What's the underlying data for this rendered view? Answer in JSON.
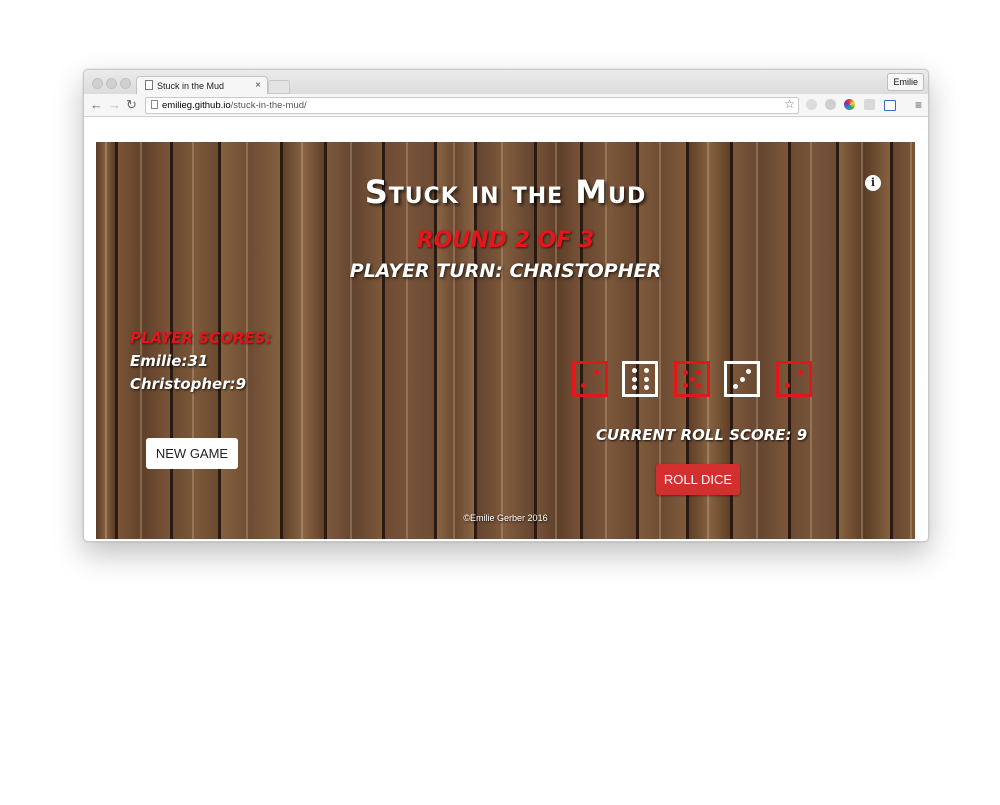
{
  "browser": {
    "tab_title": "Stuck in the Mud",
    "tab_close": "×",
    "profile_name": "Emilie",
    "url_domain": "emilieg.github.io",
    "url_path": "/stuck-in-the-mud/",
    "back": "←",
    "forward": "→",
    "reload": "↻",
    "bookmark": "☆",
    "menu": "≡"
  },
  "game": {
    "title": "Stuck in the Mud",
    "round": "ROUND 2 OF 3",
    "player_turn": "PLAYER TURN: CHRISTOPHER",
    "info": "i",
    "scores_heading": "PLAYER SCORES:",
    "scores": [
      "Emilie:31",
      "Christopher:9"
    ],
    "new_game_label": "NEW GAME",
    "current_roll_score": "CURRENT ROLL SCORE: 9",
    "roll_dice_label": "ROLL DICE",
    "footer": "©Emilie Gerber 2016",
    "dice": [
      {
        "value": 2,
        "color": "red"
      },
      {
        "value": 6,
        "color": "white"
      },
      {
        "value": 5,
        "color": "red"
      },
      {
        "value": 3,
        "color": "white"
      },
      {
        "value": 2,
        "color": "red"
      }
    ],
    "colors": {
      "red": "#e4161b",
      "white": "#ffffff",
      "roll_button": "#d32f2f"
    }
  }
}
